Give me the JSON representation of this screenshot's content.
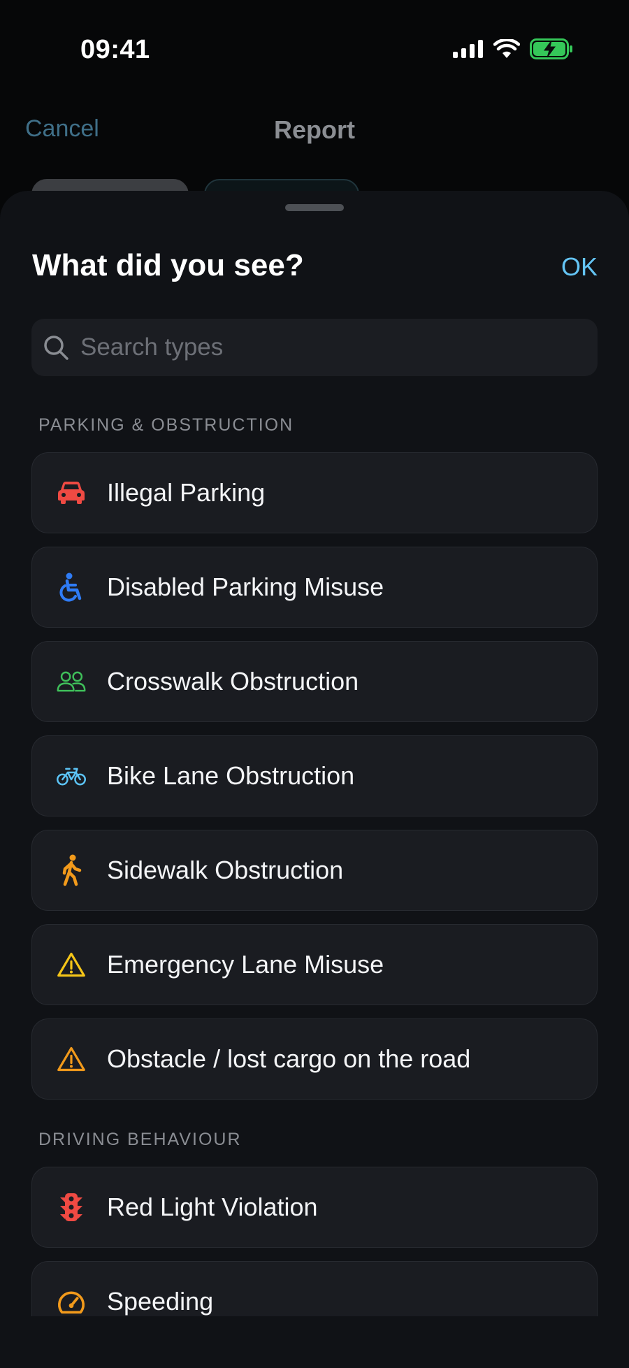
{
  "status_bar": {
    "time": "09:41"
  },
  "background_page": {
    "cancel_label": "Cancel",
    "title": "Report"
  },
  "sheet": {
    "title": "What did you see?",
    "ok_label": "OK",
    "search": {
      "placeholder": "Search types",
      "value": ""
    },
    "sections": [
      {
        "header": "PARKING & OBSTRUCTION",
        "items": [
          {
            "label": "Illegal Parking",
            "icon": "car-icon",
            "color": "#ef4a43"
          },
          {
            "label": "Disabled Parking Misuse",
            "icon": "wheelchair-icon",
            "color": "#2f7cf6"
          },
          {
            "label": "Crosswalk Obstruction",
            "icon": "people-icon",
            "color": "#3fbf5a"
          },
          {
            "label": "Bike Lane Obstruction",
            "icon": "bicycle-icon",
            "color": "#5cc4f6"
          },
          {
            "label": "Sidewalk Obstruction",
            "icon": "pedestrian-icon",
            "color": "#f29a1b"
          },
          {
            "label": "Emergency Lane Misuse",
            "icon": "warning-icon",
            "color": "#f5c518"
          },
          {
            "label": "Obstacle / lost cargo on the road",
            "icon": "warning-icon",
            "color": "#f29a1b"
          }
        ]
      },
      {
        "header": "DRIVING BEHAVIOUR",
        "items": [
          {
            "label": "Red Light Violation",
            "icon": "traffic-light-icon",
            "color": "#ef4a43"
          },
          {
            "label": "Speeding",
            "icon": "speedometer-icon",
            "color": "#f29a1b"
          }
        ]
      }
    ]
  }
}
